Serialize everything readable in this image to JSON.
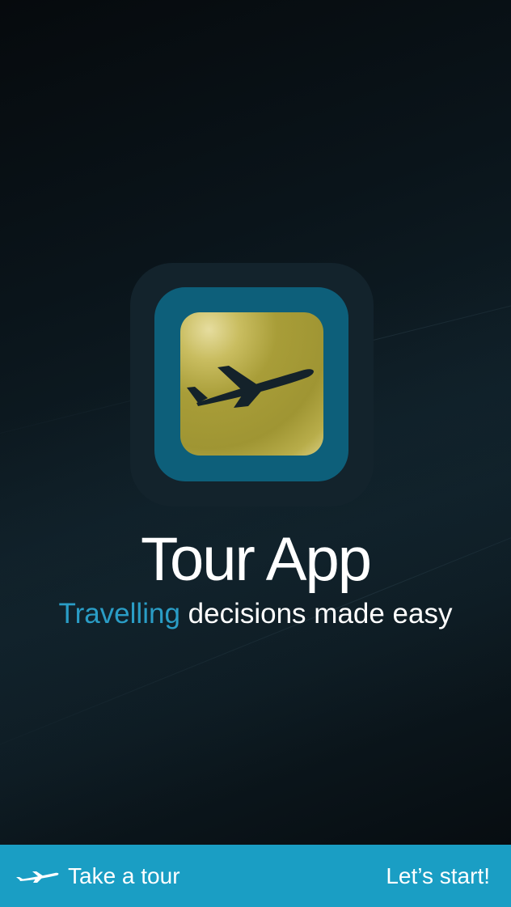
{
  "app": {
    "title": "Tour App",
    "tagline_accent": "Travelling",
    "tagline_rest": " decisions made easy"
  },
  "logo": {
    "icon": "airplane-icon"
  },
  "bottom_bar": {
    "tour_label": "Take a tour",
    "tour_icon": "airplane-icon",
    "start_label": "Let’s start!"
  },
  "colors": {
    "background": "#091116",
    "icon_ring": "#0d5f7a",
    "icon_gold": "#a89d38",
    "accent": "#2a9dc6",
    "bottom_bar": "#1a9ec4"
  }
}
